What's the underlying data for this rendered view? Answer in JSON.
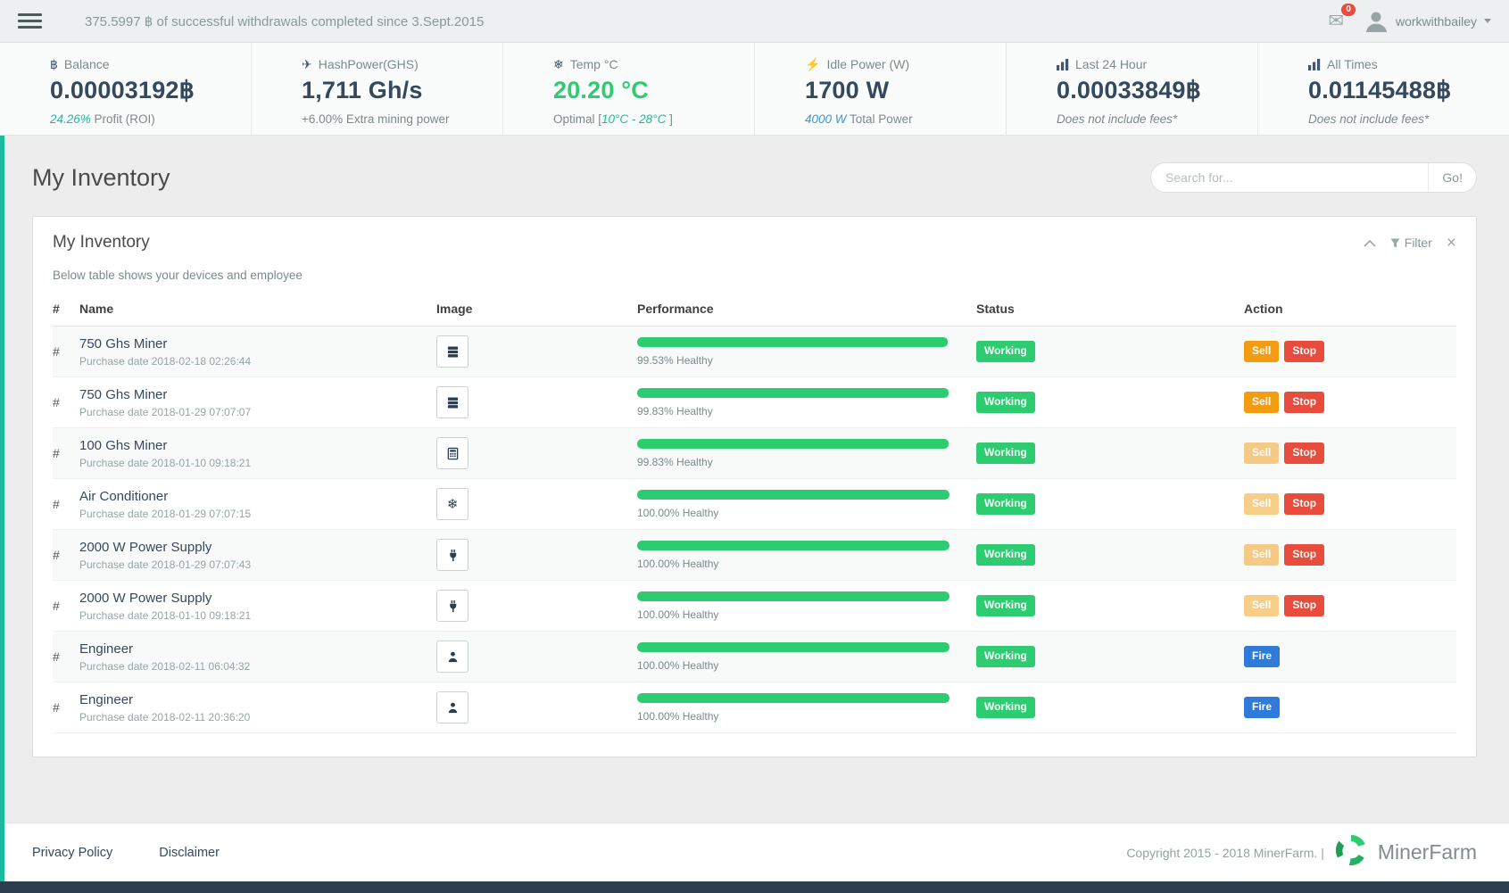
{
  "colors": {
    "success": "#2ecc71",
    "warning": "#f39c12",
    "danger": "#e74c3c",
    "info": "#2e7bd9",
    "accent": "#18bc9c"
  },
  "topbar": {
    "announcement": "375.5997 ฿ of successful withdrawals completed since 3.Sept.2015",
    "mail_badge": "0",
    "username": "workwithbailey"
  },
  "stats": [
    {
      "icon": "bitcoin-icon",
      "label": "Balance",
      "value": "0.00003192฿",
      "value_style": "dark",
      "sub": [
        {
          "text": "24.26%",
          "style": "green-italic"
        },
        {
          "text": " Profit (ROI)",
          "style": "muted"
        }
      ]
    },
    {
      "icon": "rocket-icon",
      "label": "HashPower(GHS)",
      "value": "1,711 Gh/s",
      "value_style": "dark",
      "sub": [
        {
          "text": "+6.00% Extra mining power",
          "style": "muted"
        }
      ]
    },
    {
      "icon": "snowflake-icon",
      "label": "Temp °C",
      "value": "20.20 °C",
      "value_style": "green",
      "sub": [
        {
          "text": "Optimal [",
          "style": "muted"
        },
        {
          "text": "10°C - 28°C",
          "style": "green-italic"
        },
        {
          "text": " ]",
          "style": "muted"
        }
      ]
    },
    {
      "icon": "bolt-icon",
      "label": "Idle Power (W)",
      "value": "1700 W",
      "value_style": "dark",
      "sub": [
        {
          "text": "4000 W",
          "style": "blue-italic"
        },
        {
          "text": " Total Power",
          "style": "muted"
        }
      ]
    },
    {
      "icon": "chart-icon",
      "label": "Last 24 Hour",
      "value": "0.00033849฿",
      "value_style": "dark",
      "sub": [
        {
          "text": "Does not include fees*",
          "style": "muted-italic"
        }
      ]
    },
    {
      "icon": "chart-icon",
      "label": "All Times",
      "value": "0.01145488฿",
      "value_style": "dark",
      "sub": [
        {
          "text": "Does not include fees*",
          "style": "muted-italic"
        }
      ]
    }
  ],
  "page": {
    "title": "My Inventory",
    "search_placeholder": "Search for...",
    "search_button": "Go!"
  },
  "panel": {
    "title": "My Inventory",
    "filter_label": "Filter",
    "description": "Below table shows your devices and employee"
  },
  "table": {
    "headers": [
      "#",
      "Name",
      "Image",
      "Performance",
      "Status",
      "Action"
    ],
    "rows": [
      {
        "id": "#",
        "name": "750 Ghs Miner",
        "purchase": "Purchase date 2018-02-18 02:26:44",
        "icon": "miner-icon",
        "health_pct": 99.53,
        "health_label": "99.53% Healthy",
        "status": "Working",
        "actions": [
          {
            "label": "Sell",
            "type": "warning",
            "faded": false
          },
          {
            "label": "Stop",
            "type": "danger",
            "faded": false
          }
        ]
      },
      {
        "id": "#",
        "name": "750 Ghs Miner",
        "purchase": "Purchase date 2018-01-29 07:07:07",
        "icon": "miner-icon",
        "health_pct": 99.83,
        "health_label": "99.83% Healthy",
        "status": "Working",
        "actions": [
          {
            "label": "Sell",
            "type": "warning",
            "faded": false
          },
          {
            "label": "Stop",
            "type": "danger",
            "faded": false
          }
        ]
      },
      {
        "id": "#",
        "name": "100 Ghs Miner",
        "purchase": "Purchase date 2018-01-10 09:18:21",
        "icon": "chip-icon",
        "health_pct": 99.83,
        "health_label": "99.83% Healthy",
        "status": "Working",
        "actions": [
          {
            "label": "Sell",
            "type": "warning",
            "faded": true
          },
          {
            "label": "Stop",
            "type": "danger",
            "faded": false
          }
        ]
      },
      {
        "id": "#",
        "name": "Air Conditioner",
        "purchase": "Purchase date 2018-01-29 07:07:15",
        "icon": "snowflake-icon",
        "health_pct": 100,
        "health_label": "100.00% Healthy",
        "status": "Working",
        "actions": [
          {
            "label": "Sell",
            "type": "warning",
            "faded": true
          },
          {
            "label": "Stop",
            "type": "danger",
            "faded": false
          }
        ]
      },
      {
        "id": "#",
        "name": "2000 W Power Supply",
        "purchase": "Purchase date 2018-01-29 07:07:43",
        "icon": "plug-icon",
        "health_pct": 100,
        "health_label": "100.00% Healthy",
        "status": "Working",
        "actions": [
          {
            "label": "Sell",
            "type": "warning",
            "faded": true
          },
          {
            "label": "Stop",
            "type": "danger",
            "faded": false
          }
        ]
      },
      {
        "id": "#",
        "name": "2000 W Power Supply",
        "purchase": "Purchase date 2018-01-10 09:18:21",
        "icon": "plug-icon",
        "health_pct": 100,
        "health_label": "100.00% Healthy",
        "status": "Working",
        "actions": [
          {
            "label": "Sell",
            "type": "warning",
            "faded": true
          },
          {
            "label": "Stop",
            "type": "danger",
            "faded": false
          }
        ]
      },
      {
        "id": "#",
        "name": "Engineer",
        "purchase": "Purchase date 2018-02-11 06:04:32",
        "icon": "engineer-icon",
        "health_pct": 100,
        "health_label": "100.00% Healthy",
        "status": "Working",
        "actions": [
          {
            "label": "Fire",
            "type": "info",
            "faded": false
          }
        ]
      },
      {
        "id": "#",
        "name": "Engineer",
        "purchase": "Purchase date 2018-02-11 20:36:20",
        "icon": "engineer-icon",
        "health_pct": 100,
        "health_label": "100.00% Healthy",
        "status": "Working",
        "actions": [
          {
            "label": "Fire",
            "type": "info",
            "faded": false
          }
        ]
      }
    ]
  },
  "footer": {
    "links": [
      "Privacy Policy",
      "Disclaimer"
    ],
    "copyright": "Copyright 2015 - 2018 MinerFarm. |",
    "brand": "MinerFarm"
  }
}
